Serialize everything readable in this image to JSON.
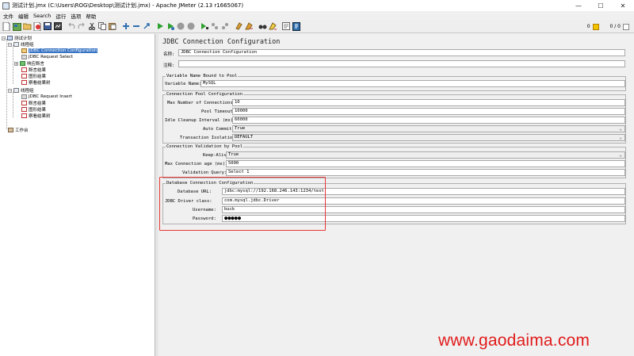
{
  "window": {
    "title": "测试计划.jmx (C:\\Users\\ROG\\Desktop\\测试计划.jmx) - Apache JMeter (2.13 r1665067)",
    "controls": {
      "minimize": "—",
      "maximize": "☐",
      "close": "✕"
    }
  },
  "menu": [
    "文件",
    "编辑",
    "Search",
    "运行",
    "选项",
    "帮助"
  ],
  "toolbar": {
    "icons": [
      "new-icon",
      "templates-icon",
      "open-icon",
      "close-icon",
      "save-icon",
      "save-as-image-icon",
      "cut-icon",
      "copy-icon",
      "paste-icon",
      "expand-icon",
      "collapse-icon",
      "toggle-icon",
      "start-icon",
      "start-no-pause-icon",
      "stop-icon",
      "shutdown-icon",
      "remote-start-icon",
      "remote-stop-icon",
      "remote-shutdown-icon",
      "clear-icon",
      "clear-all-icon",
      "search-icon",
      "reset-search-icon",
      "function-helper-icon",
      "help-icon"
    ],
    "error_count": "0",
    "active_threads": "0 / 0"
  },
  "tree": {
    "test_plan": "测试计划",
    "thread_group_1": "线程组",
    "jdbc_config": "JDBC Connection Configuration",
    "jdbc_select": "JDBC Request Select",
    "response_assertion": "响应断言",
    "assertion_results_1": "断言结果",
    "graph_results_1": "图形结果",
    "view_tree_1": "察看结果树",
    "thread_group_2": "线程组",
    "jdbc_insert": "JDBC Request Insert",
    "assertion_results_2": "断言结果",
    "graph_results_2": "图形结果",
    "view_tree_2": "察看结果树",
    "workbench": "工作台"
  },
  "panel": {
    "title": "JDBC Connection Configuration",
    "name_label": "名称:",
    "name_value": "JDBC Connection Configuration",
    "comments_label": "注释:",
    "comments_value": "",
    "variable_group": {
      "title": "Variable Name Bound to Pool",
      "label": "Variable Name:",
      "value": "MySQL"
    },
    "pool_group": {
      "title": "Connection Pool Configuration",
      "max_conn_label": "Max Number of Connections:",
      "max_conn_value": "10",
      "pool_timeout_label": "Pool Timeout:",
      "pool_timeout_value": "10000",
      "idle_cleanup_label": "Idle Cleanup Interval (ms):",
      "idle_cleanup_value": "60000",
      "auto_commit_label": "Auto Commit:",
      "auto_commit_value": "True",
      "isolation_label": "Transaction Isolation:",
      "isolation_value": "DEFAULT"
    },
    "validation_group": {
      "title": "Connection Validation by Pool",
      "keep_alive_label": "Keep-Alive:",
      "keep_alive_value": "True",
      "max_age_label": "Max Connection age (ms):",
      "max_age_value": "5000",
      "query_label": "Validation Query:",
      "query_value": "Select 1"
    },
    "db_group": {
      "title": "Database Connection Configuration",
      "url_label": "Database URL:",
      "url_value": "jdbc:mysql://192.168.246.143:1234/test",
      "driver_label": "JDBC Driver class:",
      "driver_value": "com.mysql.jdbc.Driver",
      "username_label": "Username:",
      "username_value": "buck",
      "password_label": "Password:",
      "password_value": "●●●●●"
    }
  },
  "watermark": "www.gaodaima.com",
  "colors": {
    "selection": "#3a75c4",
    "highlight_box": "#e53935",
    "watermark": "#e11b1b"
  }
}
